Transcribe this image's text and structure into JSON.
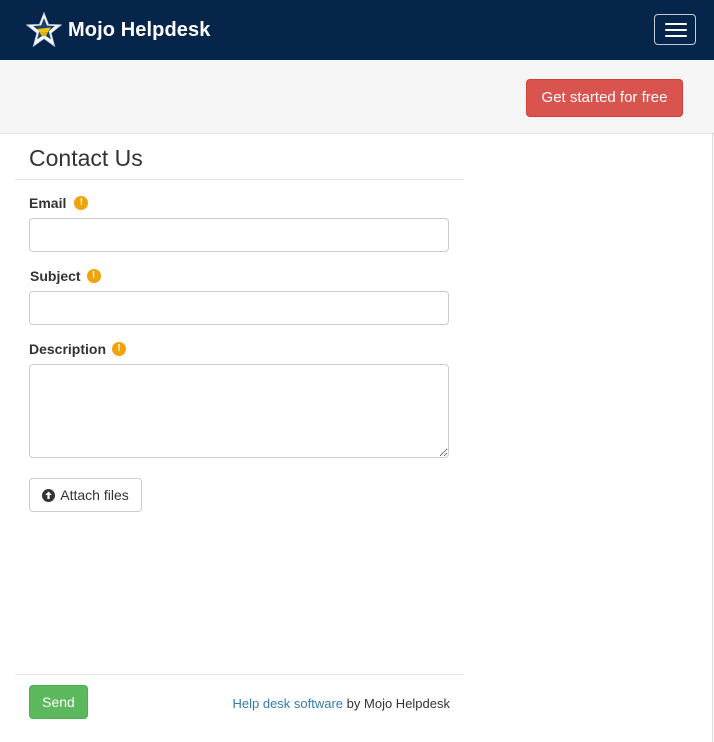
{
  "navbar": {
    "brand_name": "Mojo Helpdesk",
    "logo_icon": "star-logo-icon",
    "menu_icon": "hamburger-menu-icon",
    "background_color": "#06254a"
  },
  "cta": {
    "label": "Get started for free",
    "color": "#d9534f"
  },
  "form": {
    "title": "Contact Us",
    "required_icon": "exclamation-circle-icon",
    "required_color": "#f0a30a",
    "fields": {
      "email": {
        "label": "Email",
        "value": "",
        "placeholder": ""
      },
      "subject": {
        "label": "Subject",
        "value": "",
        "placeholder": ""
      },
      "description": {
        "label": "Description",
        "value": "",
        "placeholder": ""
      }
    },
    "attach_label": "Attach files",
    "attach_icon": "upload-circle-icon",
    "send_label": "Send",
    "send_color": "#5cb85c"
  },
  "footer": {
    "link_text": "Help desk software",
    "suffix_text": "by Mojo Helpdesk",
    "link_color": "#337ab7"
  }
}
